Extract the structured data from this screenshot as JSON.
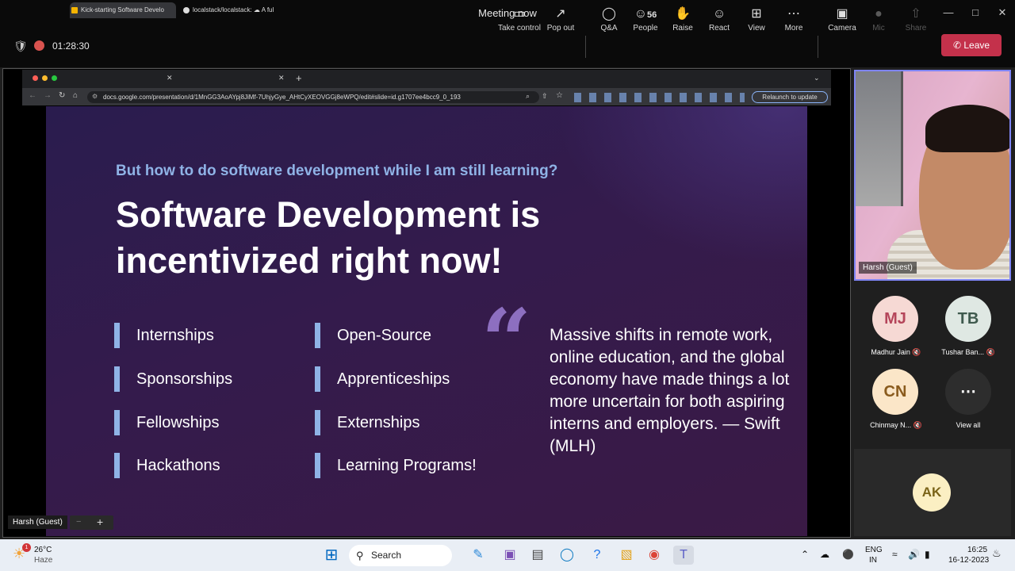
{
  "window": {
    "title": "Meeting now"
  },
  "toolbar": {
    "timer": "01:28:30",
    "people_count": "56",
    "buttons": [
      {
        "label": "Take control",
        "icon": "take-control-icon"
      },
      {
        "label": "Pop out",
        "icon": "pop-out-icon"
      },
      {
        "label": "Q&A",
        "icon": "qa-icon"
      },
      {
        "label": "People",
        "icon": "people-icon"
      },
      {
        "label": "Raise",
        "icon": "raise-hand-icon"
      },
      {
        "label": "React",
        "icon": "react-icon"
      },
      {
        "label": "View",
        "icon": "view-icon"
      },
      {
        "label": "More",
        "icon": "more-icon"
      },
      {
        "label": "Camera",
        "icon": "camera-off-icon"
      },
      {
        "label": "Mic",
        "icon": "mic-icon"
      },
      {
        "label": "Share",
        "icon": "share-icon"
      }
    ],
    "leave": "Leave"
  },
  "browser": {
    "tabs": [
      "Kick-starting Software Develo",
      "localstack/localstack: ☁ A ful"
    ],
    "url": "docs.google.com/presentation/d/1MnGG3AoAYpj8JiMf-7UhjyGye_AHtCyXEOVGGj8eWPQ/edit#slide=id.g1707ee4bcc9_0_193",
    "relaunch": "Relaunch to update"
  },
  "slide": {
    "subtitle": "But how to do software development while I am still learning?",
    "heading": "Software Development is incentivized right now!",
    "col1": [
      "Internships",
      "Sponsorships",
      "Fellowships",
      "Hackathons"
    ],
    "col2": [
      "Open-Source",
      "Apprenticeships",
      "Externships",
      "Learning Programs!"
    ],
    "quote": "Massive shifts in remote work, online education, and the global economy have made things a lot more uncertain for both aspiring interns and employers. — Swift (MLH)"
  },
  "share_label": "Harsh (Guest)",
  "video": {
    "name": "Harsh (Guest)"
  },
  "participants": [
    {
      "initials": "MJ",
      "name": "Madhur Jain",
      "bg": "#f6d9d4",
      "fg": "#b5455a"
    },
    {
      "initials": "TB",
      "name": "Tushar Ban...",
      "bg": "#dfe8e3",
      "fg": "#3f5a4e"
    },
    {
      "initials": "CN",
      "name": "Chinmay N...",
      "bg": "#fbe6c8",
      "fg": "#8a5b1d"
    },
    {
      "initials": "⋯",
      "name": "View all",
      "bg": "#2d2d2d",
      "fg": "#ffffff"
    }
  ],
  "ak": {
    "initials": "AK",
    "bg": "#fbefc3",
    "fg": "#7a6318"
  },
  "taskbar": {
    "weather_temp": "26°C",
    "weather_desc": "Haze",
    "search": "Search",
    "lang1": "ENG",
    "lang2": "IN",
    "time": "16:25",
    "date": "16-12-2023"
  }
}
